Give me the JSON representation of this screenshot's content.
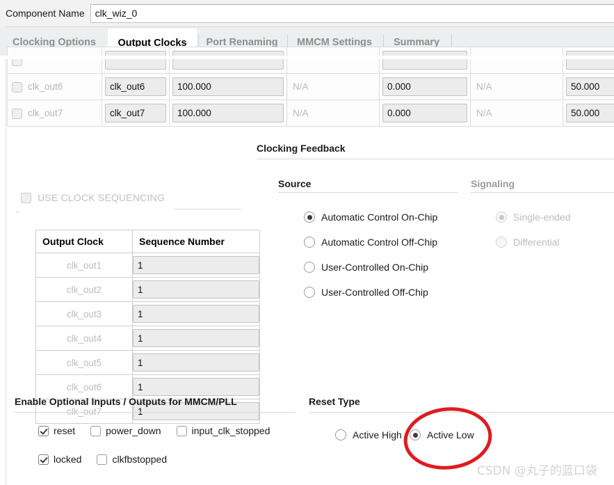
{
  "component": {
    "label": "Component Name",
    "value": "clk_wiz_0"
  },
  "tabs": [
    {
      "label": "Clocking Options",
      "active": false
    },
    {
      "label": "Output Clocks",
      "active": true
    },
    {
      "label": "Port Renaming",
      "active": false
    },
    {
      "label": "MMCM Settings",
      "active": false
    },
    {
      "label": "Summary",
      "active": false
    }
  ],
  "output_clock_table": {
    "rows": [
      {
        "enabled": false,
        "name": "clk_out6",
        "port": "clk_out6",
        "freq": "100.000",
        "actual_freq": "N/A",
        "phase": "0.000",
        "actual_phase": "N/A",
        "duty": "50.000"
      },
      {
        "enabled": false,
        "name": "clk_out7",
        "port": "clk_out7",
        "freq": "100.000",
        "actual_freq": "N/A",
        "phase": "0.000",
        "actual_phase": "N/A",
        "duty": "50.000"
      }
    ]
  },
  "clock_sequencing": {
    "checkbox_label": "USE CLOCK SEQUENCING",
    "checked": false,
    "headers": [
      "Output Clock",
      "Sequence Number"
    ],
    "rows": [
      {
        "clock": "clk_out1",
        "sequence": "1"
      },
      {
        "clock": "clk_out2",
        "sequence": "1"
      },
      {
        "clock": "clk_out3",
        "sequence": "1"
      },
      {
        "clock": "clk_out4",
        "sequence": "1"
      },
      {
        "clock": "clk_out5",
        "sequence": "1"
      },
      {
        "clock": "clk_out6",
        "sequence": "1"
      },
      {
        "clock": "clk_out7",
        "sequence": "1"
      }
    ]
  },
  "clocking_feedback": {
    "title": "Clocking Feedback",
    "source": {
      "title": "Source",
      "options": [
        {
          "label": "Automatic Control On-Chip",
          "selected": true,
          "disabled": false
        },
        {
          "label": "Automatic Control Off-Chip",
          "selected": false,
          "disabled": false
        },
        {
          "label": "User-Controlled On-Chip",
          "selected": false,
          "disabled": false
        },
        {
          "label": "User-Controlled Off-Chip",
          "selected": false,
          "disabled": false
        }
      ]
    },
    "signaling": {
      "title": "Signaling",
      "options": [
        {
          "label": "Single-ended",
          "selected": true,
          "disabled": true
        },
        {
          "label": "Differential",
          "selected": false,
          "disabled": true
        }
      ]
    }
  },
  "optional_io": {
    "title": "Enable Optional Inputs / Outputs for MMCM/PLL",
    "row1": [
      {
        "label": "reset",
        "checked": true
      },
      {
        "label": "power_down",
        "checked": false
      },
      {
        "label": "input_clk_stopped",
        "checked": false
      }
    ],
    "row2": [
      {
        "label": "locked",
        "checked": true
      },
      {
        "label": "clkfbstopped",
        "checked": false
      }
    ]
  },
  "reset_type": {
    "title": "Reset Type",
    "options": [
      {
        "label": "Active High",
        "selected": false
      },
      {
        "label": "Active Low",
        "selected": true
      }
    ]
  },
  "annotation": {
    "shape": "ellipse",
    "color": "#e01b20",
    "target": "Active Low"
  },
  "watermark": {
    "text": "CSDN @丸子的蓝口袋"
  }
}
